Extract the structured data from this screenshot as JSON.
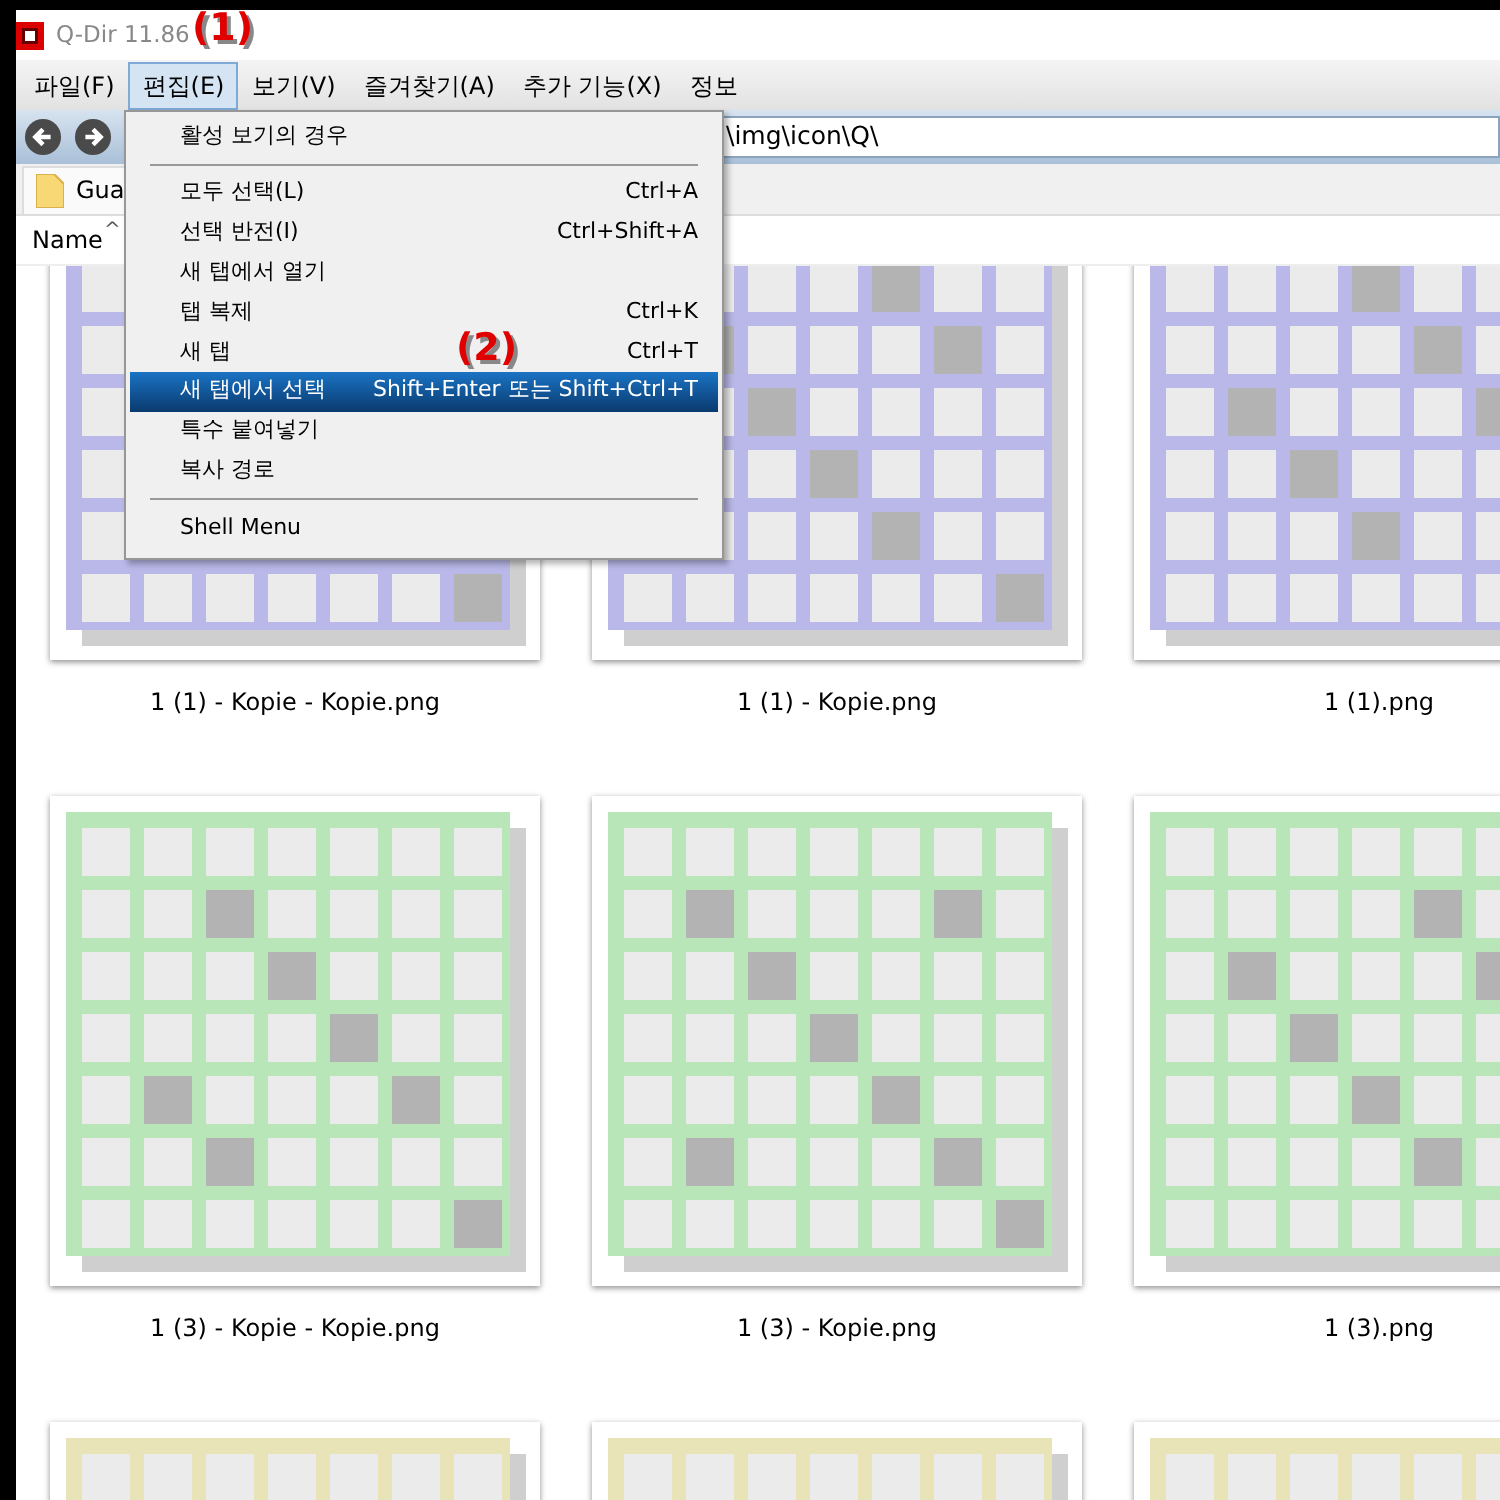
{
  "window": {
    "title": "Q-Dir 11.86"
  },
  "annotations": [
    {
      "label": "(1)"
    },
    {
      "label": "(2)"
    }
  ],
  "menubar": [
    {
      "label": "파일(F)",
      "selected": false
    },
    {
      "label": "편집(E)",
      "selected": true
    },
    {
      "label": "보기(V)",
      "selected": false
    },
    {
      "label": "즐겨찾기(A)",
      "selected": false
    },
    {
      "label": "추가 기능(X)",
      "selected": false
    },
    {
      "label": "정보",
      "selected": false
    }
  ],
  "address": {
    "value": "\\img\\icon\\Q\\"
  },
  "tab": {
    "label": "Gua"
  },
  "column_header": {
    "label": "Name",
    "sort": "^"
  },
  "menu": [
    {
      "kind": "item",
      "label": "활성 보기의 경우",
      "selected": false
    },
    {
      "kind": "separator"
    },
    {
      "kind": "item",
      "label": "모두 선택(L)",
      "shortcut": "Ctrl+A",
      "selected": false
    },
    {
      "kind": "item",
      "label": "선택 반전(I)",
      "shortcut": "Ctrl+Shift+A",
      "selected": false
    },
    {
      "kind": "item",
      "label": "새 탭에서 열기",
      "selected": false
    },
    {
      "kind": "item",
      "label": "탭 복제",
      "shortcut": "Ctrl+K",
      "selected": false
    },
    {
      "kind": "item",
      "label": "새 탭",
      "shortcut": "Ctrl+T",
      "selected": false
    },
    {
      "kind": "item",
      "label": "새 탭에서 선택",
      "shortcut": "Shift+Enter 또는 Shift+Ctrl+T",
      "selected": true
    },
    {
      "kind": "item",
      "label": "특수 붙여넣기",
      "selected": false
    },
    {
      "kind": "item",
      "label": "복사 경로",
      "selected": false
    },
    {
      "kind": "separator"
    },
    {
      "kind": "item",
      "label": "Shell Menu",
      "selected": false
    }
  ],
  "files": [
    {
      "name": "1 (1) - Kopie - Kopie.png",
      "color": "#b9b8e8"
    },
    {
      "name": "1 (1) - Kopie.png",
      "color": "#b9b8e8"
    },
    {
      "name": "1 (1).png",
      "color": "#b9b8e8"
    },
    {
      "name": "1 (3) - Kopie - Kopie.png",
      "color": "#b9e6b8"
    },
    {
      "name": "1 (3) - Kopie.png",
      "color": "#b9e6b8"
    },
    {
      "name": "1 (3).png",
      "color": "#b9e6b8"
    },
    {
      "color": "#e9e3b8"
    },
    {
      "color": "#e9e3b8"
    },
    {
      "color": "#e9e3b8"
    }
  ]
}
